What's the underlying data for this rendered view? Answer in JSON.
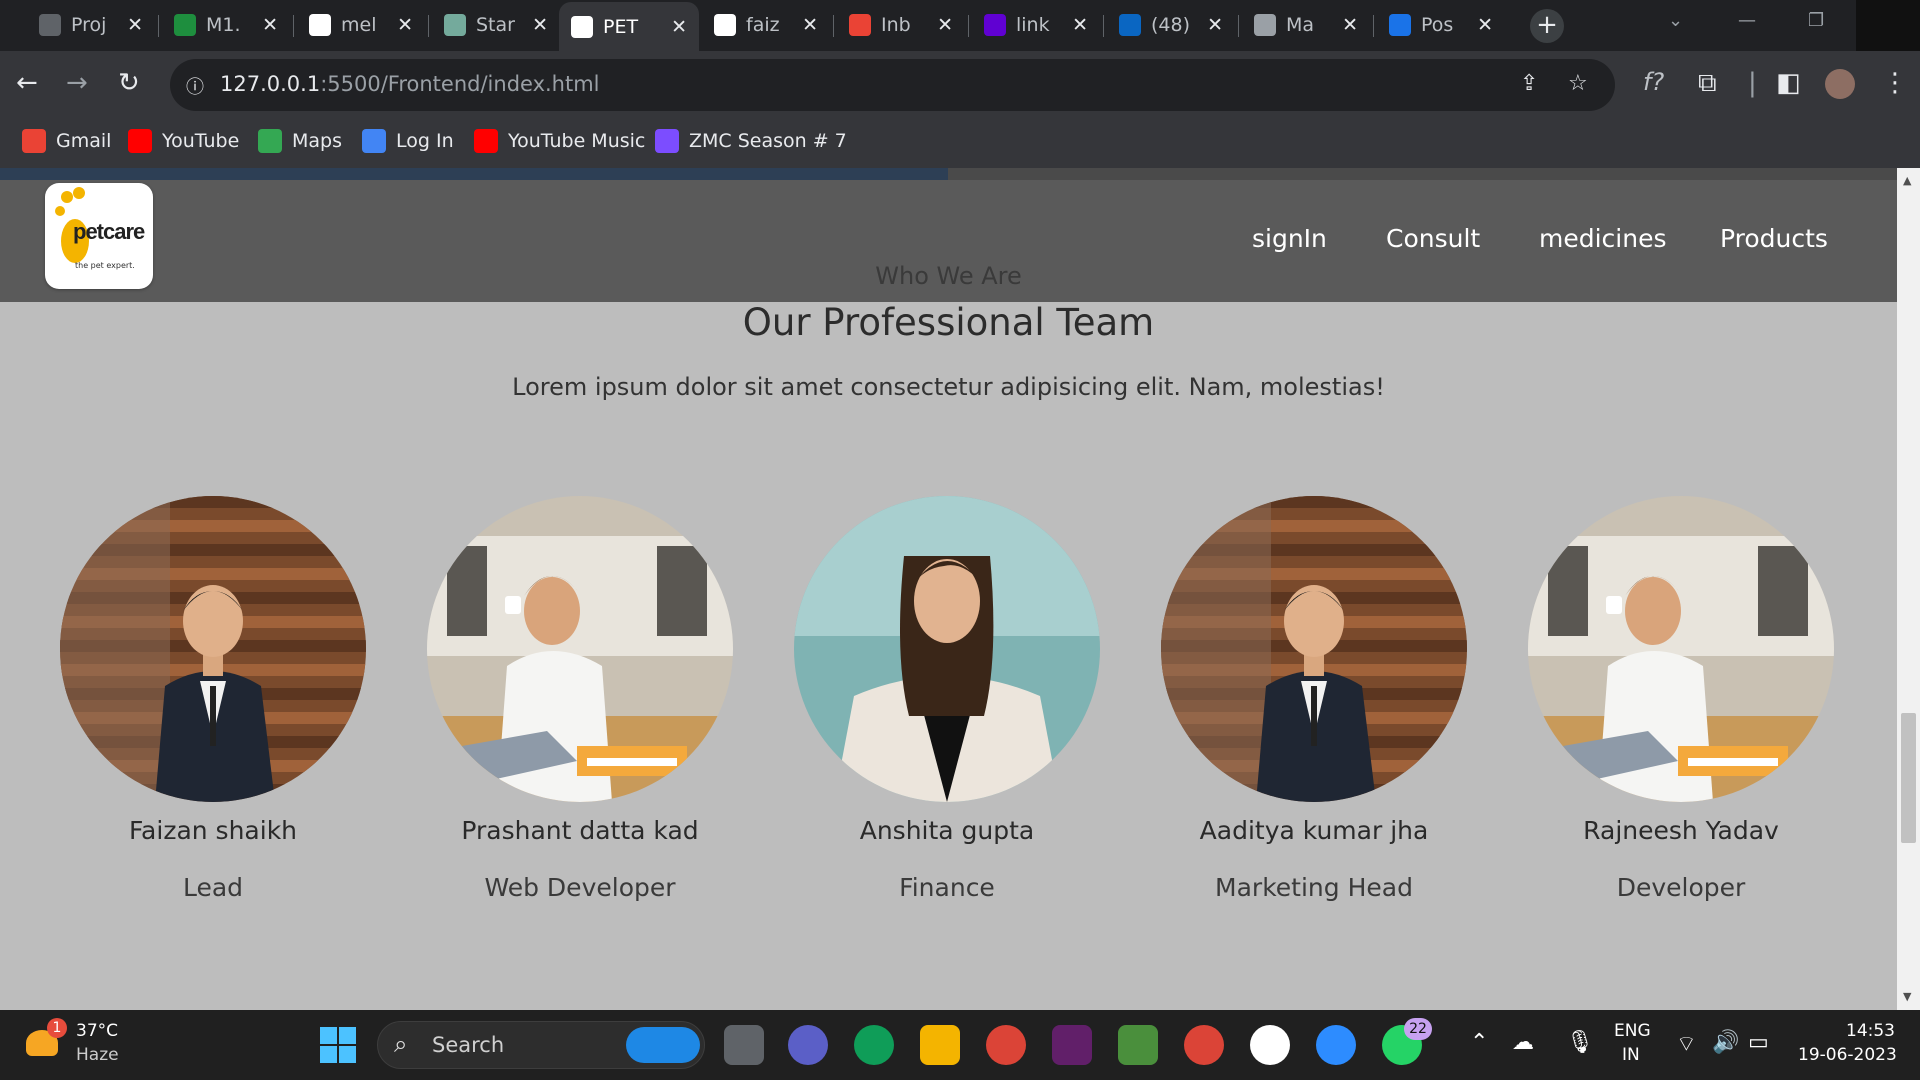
{
  "browser": {
    "tabs": [
      {
        "label": "Proj",
        "color": "#5f6368",
        "active": false
      },
      {
        "label": "M1.",
        "color": "#1e8e3e",
        "active": false
      },
      {
        "label": "mel",
        "color": "#ffffff",
        "active": false
      },
      {
        "label": "Star",
        "color": "#74aa9c",
        "active": false
      },
      {
        "label": "PET",
        "color": "#ffffff",
        "active": true
      },
      {
        "label": "faiz",
        "color": "#ffffff",
        "active": false
      },
      {
        "label": "Inb",
        "color": "#ea4335",
        "active": false
      },
      {
        "label": "link",
        "color": "#6001d2",
        "active": false
      },
      {
        "label": "(48)",
        "color": "#0a66c2",
        "active": false
      },
      {
        "label": "Ma",
        "color": "#9aa0a6",
        "active": false
      },
      {
        "label": "Pos",
        "color": "#1a73e8",
        "active": false
      }
    ],
    "tab_close": "✕",
    "new_tab": "+",
    "url_host": "127.0.0.1",
    "url_rest": ":5500/Frontend/index.html",
    "bookmarks": [
      {
        "label": "Gmail",
        "color": "#ea4335"
      },
      {
        "label": "YouTube",
        "color": "#ff0000"
      },
      {
        "label": "Maps",
        "color": "#34a853"
      },
      {
        "label": "Log In",
        "color": "#4285f4"
      },
      {
        "label": "YouTube Music",
        "color": "#ff0000"
      },
      {
        "label": "ZMC Season # 7",
        "color": "#7c4dff"
      }
    ]
  },
  "site": {
    "logo_text": "petcare",
    "logo_tagline": "the pet expert.",
    "nav": [
      "signIn",
      "Consult",
      "medicines",
      "Products"
    ],
    "eyebrow": "Who We Are",
    "title": "Our Professional Team",
    "subtitle": "Lorem ipsum dolor sit amet consectetur adipisicing elit. Nam, molestias!",
    "team": [
      {
        "name": "Faizan shaikh",
        "role": "Lead",
        "photo": "suit"
      },
      {
        "name": "Prashant datta kad",
        "role": "Web Developer",
        "photo": "cafe"
      },
      {
        "name": "Anshita gupta",
        "role": "Finance",
        "photo": "woman"
      },
      {
        "name": "Aaditya kumar jha",
        "role": "Marketing Head",
        "photo": "suit"
      },
      {
        "name": "Rajneesh Yadav",
        "role": "Developer",
        "photo": "cafe"
      }
    ]
  },
  "taskbar": {
    "weather_temp": "37°C",
    "weather_desc": "Haze",
    "weather_badge": "1",
    "search_label": "Search",
    "lang_top": "ENG",
    "lang_bottom": "IN",
    "time": "14:53",
    "date": "19-06-2023",
    "whatsapp_badge": "22"
  }
}
